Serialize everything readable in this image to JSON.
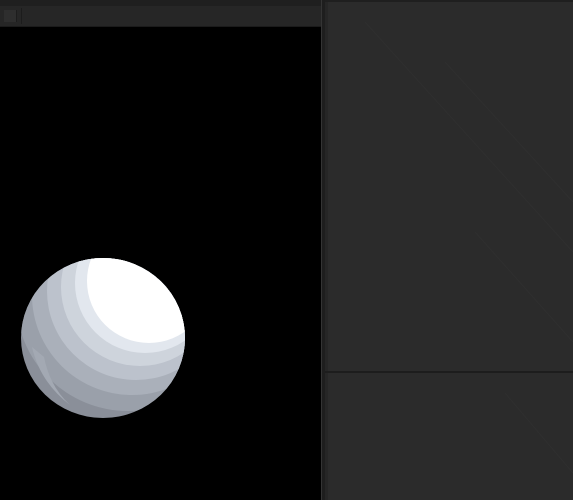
{
  "colors": {
    "background": "#2b2b2b",
    "viewport": "#000000",
    "sphere_highlight": "#ffffff",
    "sphere_shadow": "#8a8f99"
  },
  "viewport": {
    "object": "sphere",
    "shading": "toon"
  },
  "icons": {
    "toolbar_grip": "grip-icon"
  }
}
